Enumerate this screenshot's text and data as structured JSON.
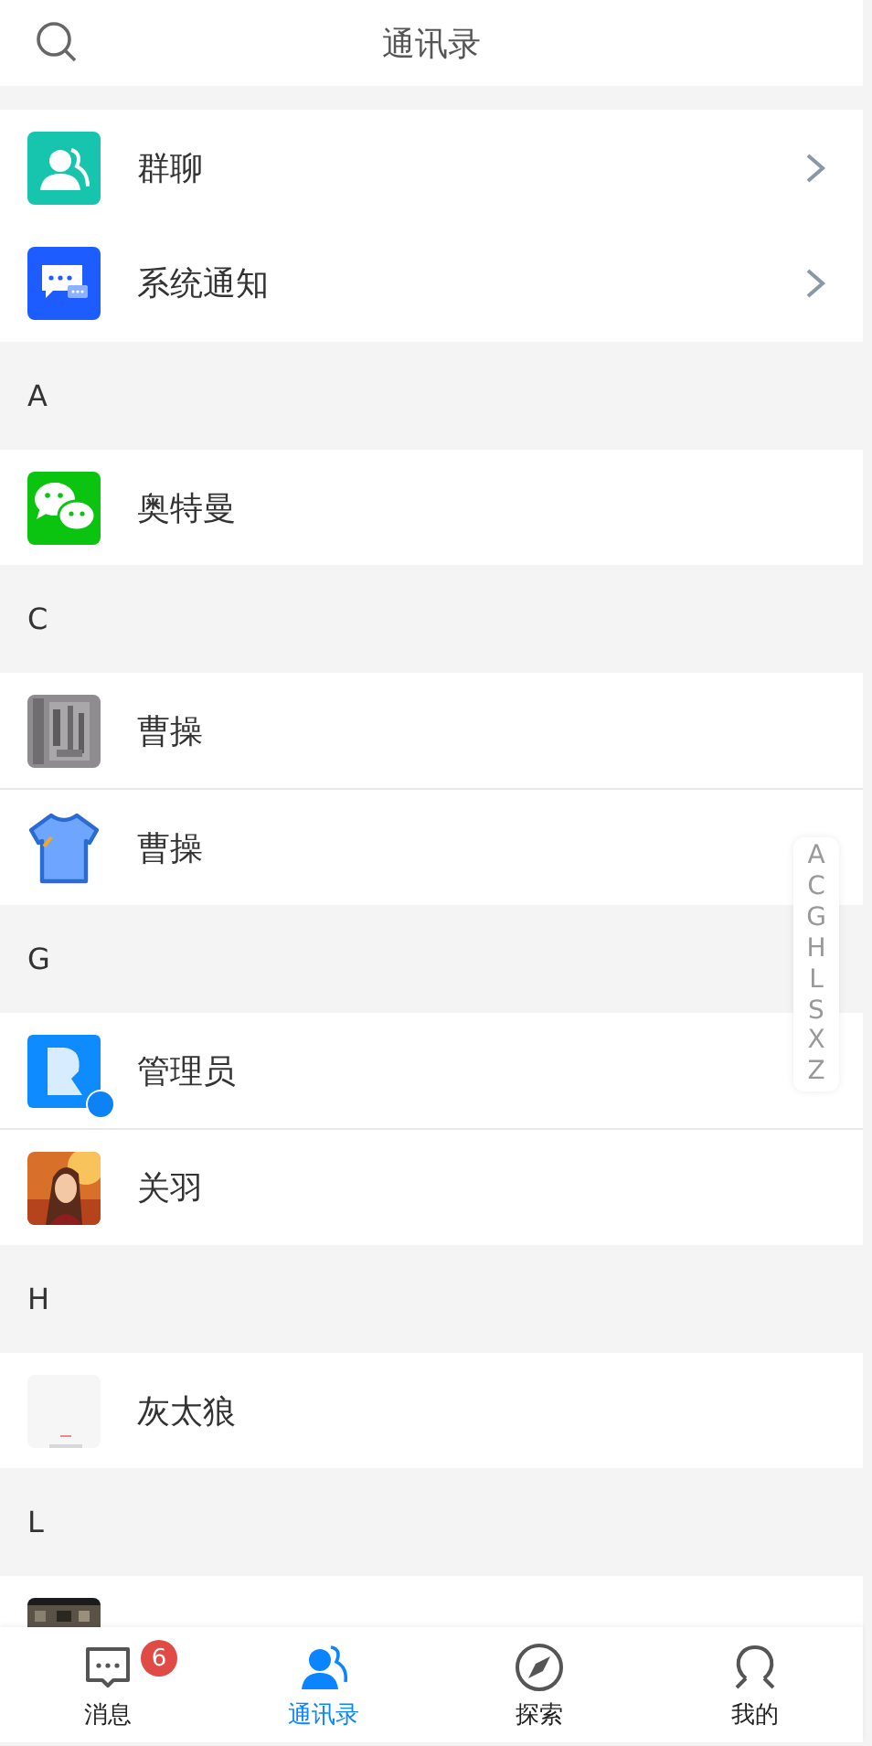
{
  "header": {
    "title": "通讯录"
  },
  "entries": [
    {
      "label": "群聊",
      "kind": "group",
      "chevron": true
    },
    {
      "label": "系统通知",
      "kind": "notice",
      "chevron": true
    }
  ],
  "sections": [
    {
      "letter": "A",
      "contacts": [
        {
          "name": "奥特曼",
          "kind": "bubbles"
        }
      ]
    },
    {
      "letter": "C",
      "contacts": [
        {
          "name": "曹操",
          "kind": "picture"
        },
        {
          "name": "曹操",
          "kind": "shirt"
        }
      ]
    },
    {
      "letter": "G",
      "contacts": [
        {
          "name": "管理员",
          "kind": "admin"
        },
        {
          "name": "关羽",
          "kind": "picture"
        }
      ]
    },
    {
      "letter": "H",
      "contacts": [
        {
          "name": "灰太狼",
          "kind": "picture"
        }
      ]
    },
    {
      "letter": "L"
    }
  ],
  "index": [
    "A",
    "C",
    "G",
    "H",
    "L",
    "S",
    "X",
    "Z"
  ],
  "tabs": [
    {
      "label": "消息",
      "kind": "messages",
      "selected": false,
      "badge": "6"
    },
    {
      "label": "通讯录",
      "kind": "contacts",
      "selected": true
    },
    {
      "label": "探索",
      "kind": "explore",
      "selected": false
    },
    {
      "label": "我的",
      "kind": "profile",
      "selected": false
    }
  ]
}
